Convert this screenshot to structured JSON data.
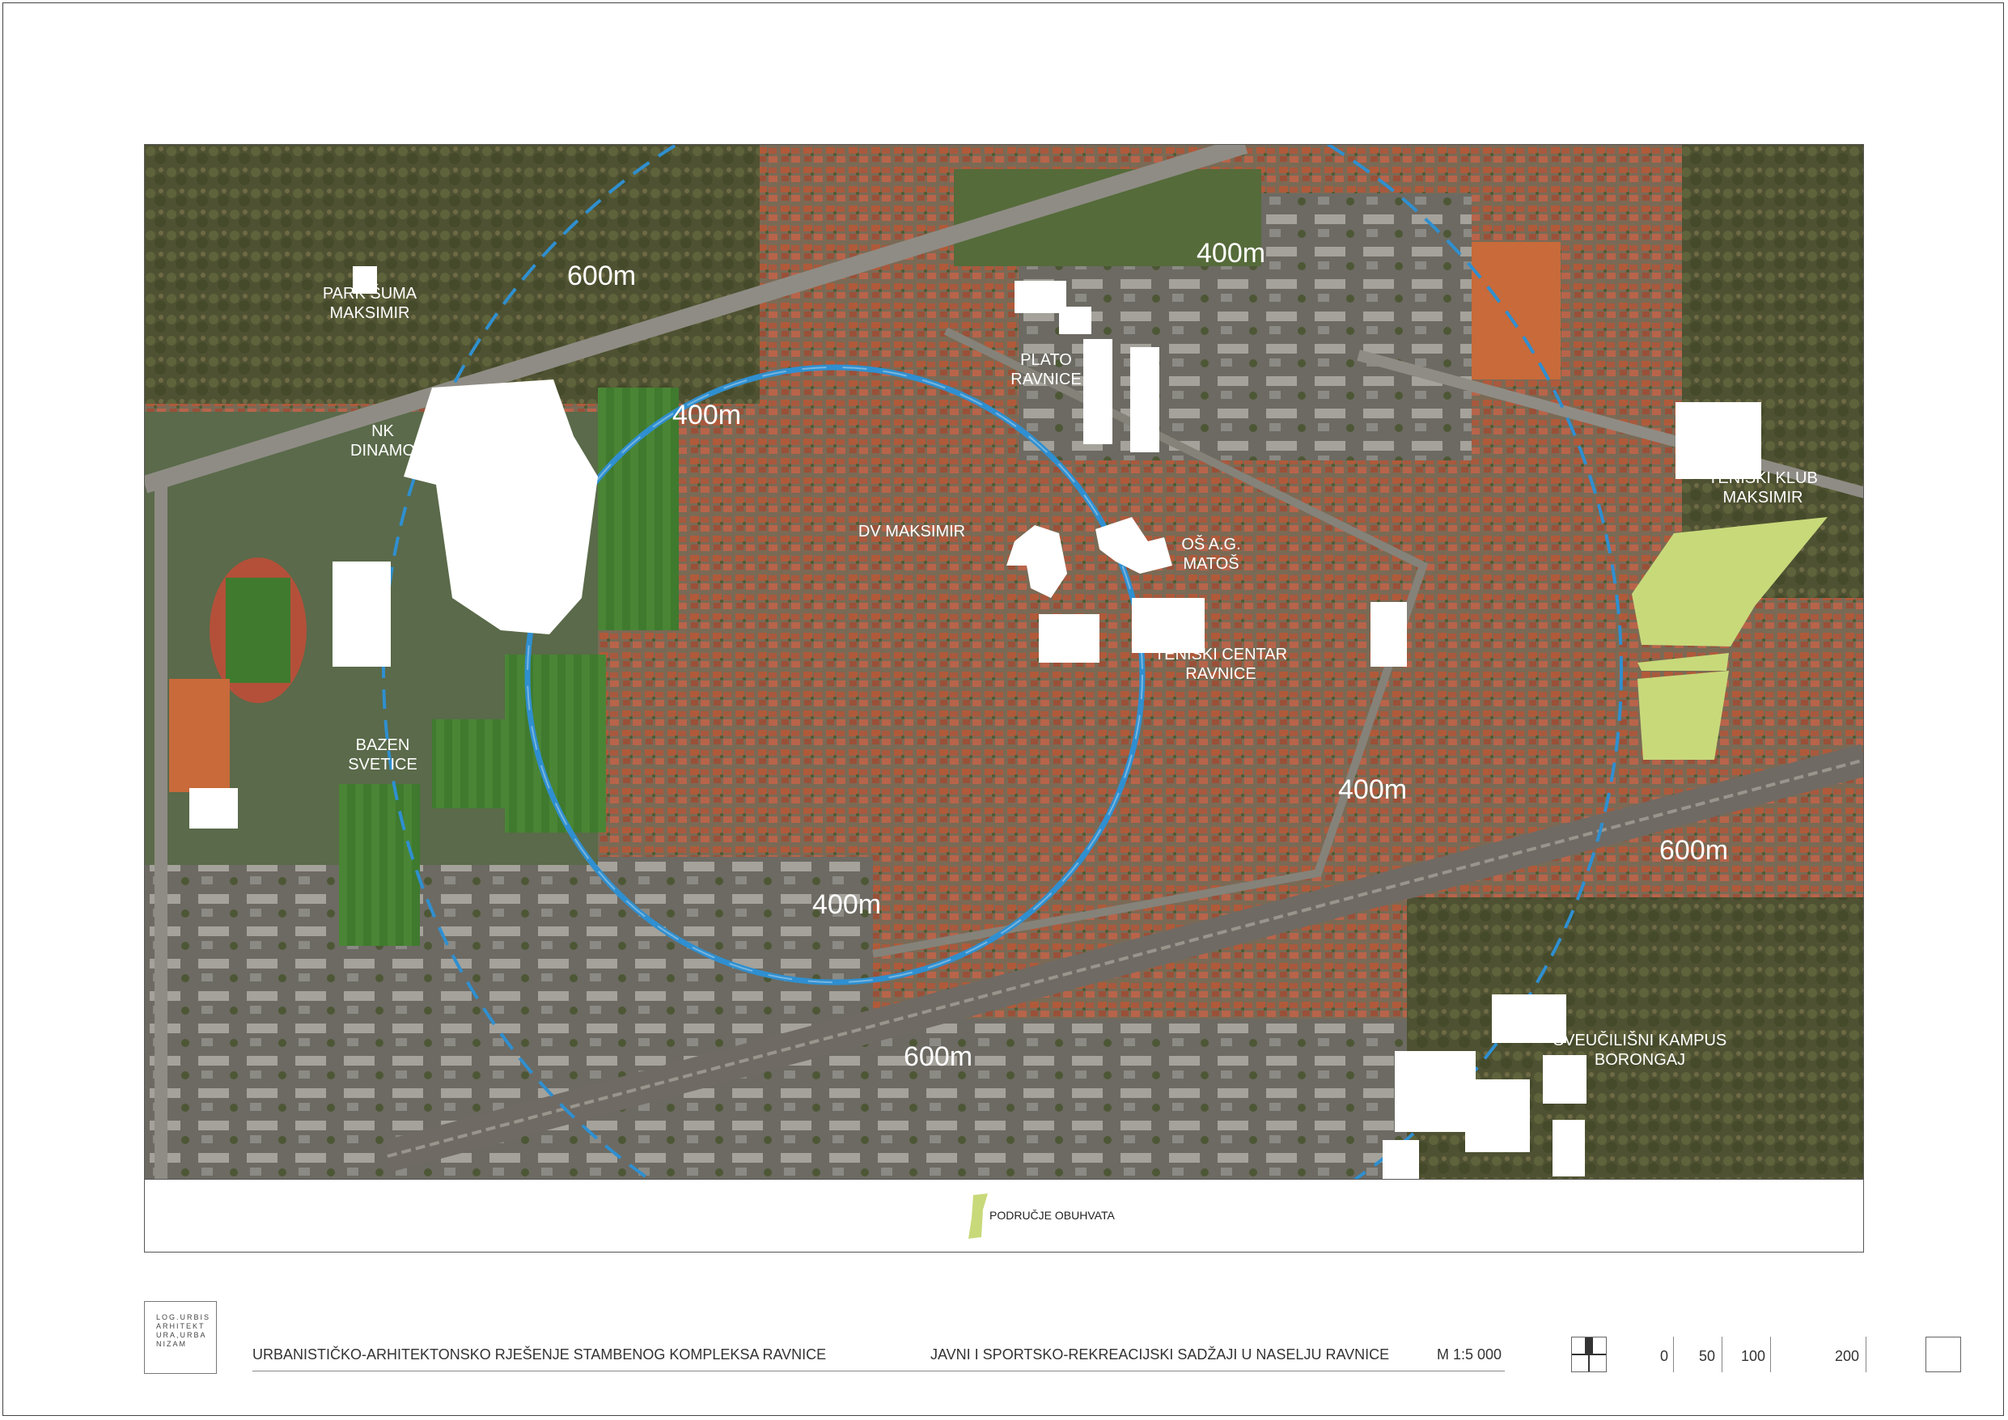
{
  "map": {
    "ring_labels": {
      "r400_top": "400m",
      "r400_left": "400m",
      "r400_right": "400m",
      "r400_bottom": "400m",
      "r600_top_left": "600m",
      "r600_right": "600m",
      "r600_bottom": "600m"
    },
    "places": {
      "park_line1": "PARK ŠUMA",
      "park_line2": "MAKSIMIR",
      "nk_line1": "NK",
      "nk_line2": "DINAMO",
      "bazen_line1": "BAZEN",
      "bazen_line2": "SVETICE",
      "plato_line1": "PLATO",
      "plato_line2": "RAVNICE",
      "dv": "DV MAKSIMIR",
      "os_line1": "OŠ A.G.",
      "os_line2": "MATOŠ",
      "teniski_centar_line1": "TENISKI CENTAR",
      "teniski_centar_line2": "RAVNICE",
      "teniski_klub_line1": "TENISKI KLUB",
      "teniski_klub_line2": "MAKSIMIR",
      "kampus_line1": "SVEUČILIŠNI KAMPUS",
      "kampus_line2": "BORONGAJ"
    },
    "colors": {
      "ring_blue": "#2f8fd0",
      "area_green": "#c8d97a",
      "building_white": "#ffffff"
    }
  },
  "legend": {
    "area_label": "PODRUČJE OBUHVATA",
    "swatch_color": "#c8d97a"
  },
  "footer": {
    "logo_lines": [
      "LOG.URBIS",
      "ARHITEKT",
      "URA,URBA",
      "NIZAM"
    ],
    "project_title": "URBANISTIČKO-ARHITEKTONSKO RJEŠENJE STAMBENOG KOMPLEKSA RAVNICE",
    "sheet_title": "JAVNI I SPORTSKO-REKREACIJSKI SADŽAJI U NASELJU RAVNICE",
    "scale": "M 1:5 000",
    "north_icon": "north-arrow-icon",
    "scale_bar": [
      "0",
      "50",
      "100",
      "200"
    ]
  }
}
